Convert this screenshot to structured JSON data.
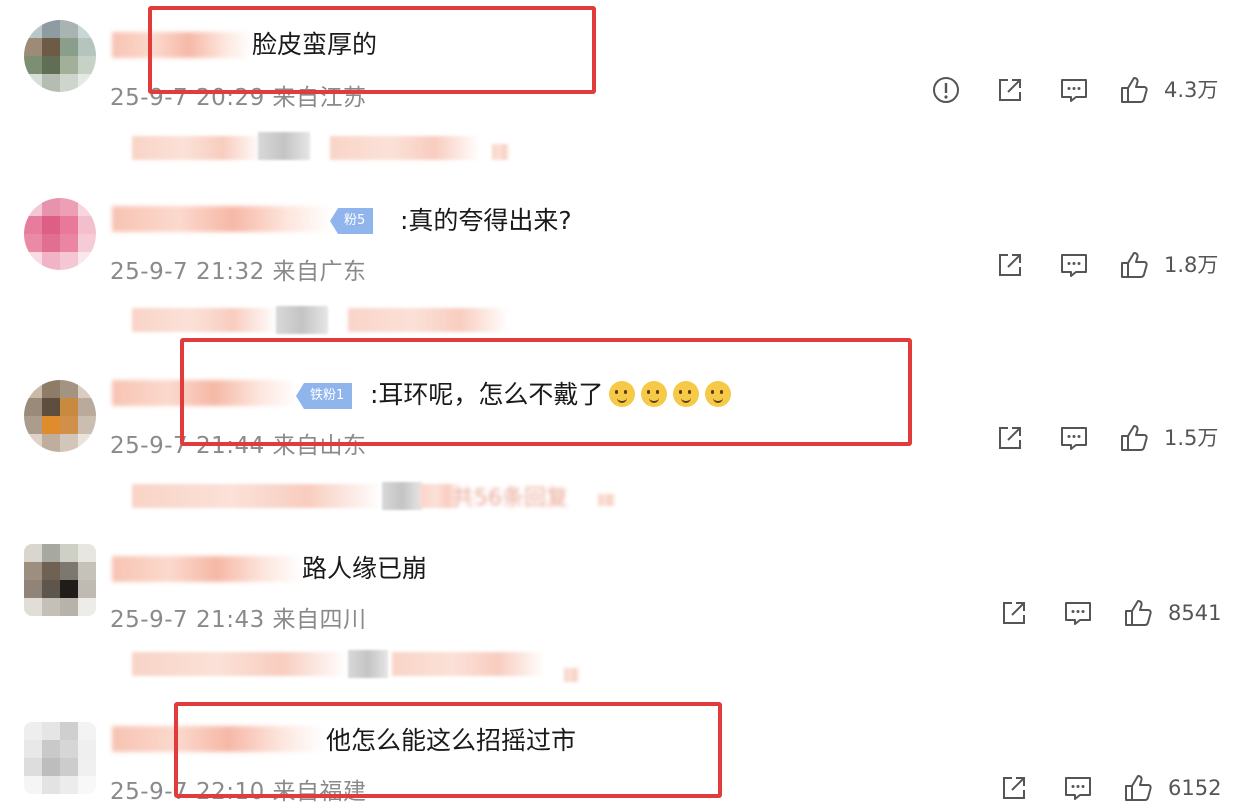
{
  "comments": [
    {
      "text": "脸皮蛮厚的",
      "meta": "25-9-7 20:29 来自江苏",
      "likes": "4.3万",
      "badge": ""
    },
    {
      "text": ":真的夸得出来?",
      "meta": "25-9-7 21:32 来自广东",
      "likes": "1.8万",
      "badge": "粉5"
    },
    {
      "text": ":耳环呢，怎么不戴了",
      "meta": "25-9-7 21:44 来自山东",
      "likes": "1.5万",
      "badge": "铁粉1",
      "reply_hint": "共56条回复"
    },
    {
      "text": "路人缘已崩",
      "meta": "25-9-7 21:43 来自四川",
      "likes": "8541",
      "badge": ""
    },
    {
      "text": "他怎么能这么招摇过市",
      "meta": "25-9-7 22:10 来自福建",
      "likes": "6152",
      "badge": ""
    }
  ],
  "icons": {
    "report": "report-icon",
    "share": "share-icon",
    "comment": "comment-icon",
    "like": "like-icon"
  },
  "colors": {
    "highlight": "#e23b3b",
    "badge": "#8fb5ec",
    "meta": "#8a8a8a"
  }
}
